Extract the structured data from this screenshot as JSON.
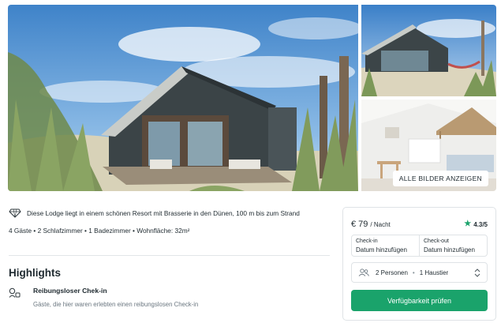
{
  "gallery": {
    "show_all_label": "ALLE BILDER ANZEIGEN"
  },
  "listing": {
    "description": "Diese Lodge liegt in einem schönen Resort mit Brasserie in den Dünen, 100 m bis zum Strand",
    "facts": "4 Gäste • 2 Schlafzimmer • 1 Badezimmer • Wohnfläche: 32m²",
    "description_icon": "diamond-icon"
  },
  "highlights": {
    "title": "Highlights",
    "items": [
      {
        "icon": "key-icon",
        "title": "Reibungsloser Chek-in",
        "description": "Gäste, die hier waren erlebten einen reibungslosen Check-in"
      }
    ]
  },
  "booking": {
    "price": "€ 79",
    "per_night": "/ Nacht",
    "rating": "4.3/5",
    "checkin_label": "Check-in",
    "checkin_value": "Datum hinzufügen",
    "checkout_label": "Check-out",
    "checkout_value": "Datum hinzufügen",
    "guests": "2 Personen",
    "pets": "1 Haustier",
    "submit_label": "Verfügbarkeit prüfen",
    "accent_color": "#1aa36b"
  }
}
